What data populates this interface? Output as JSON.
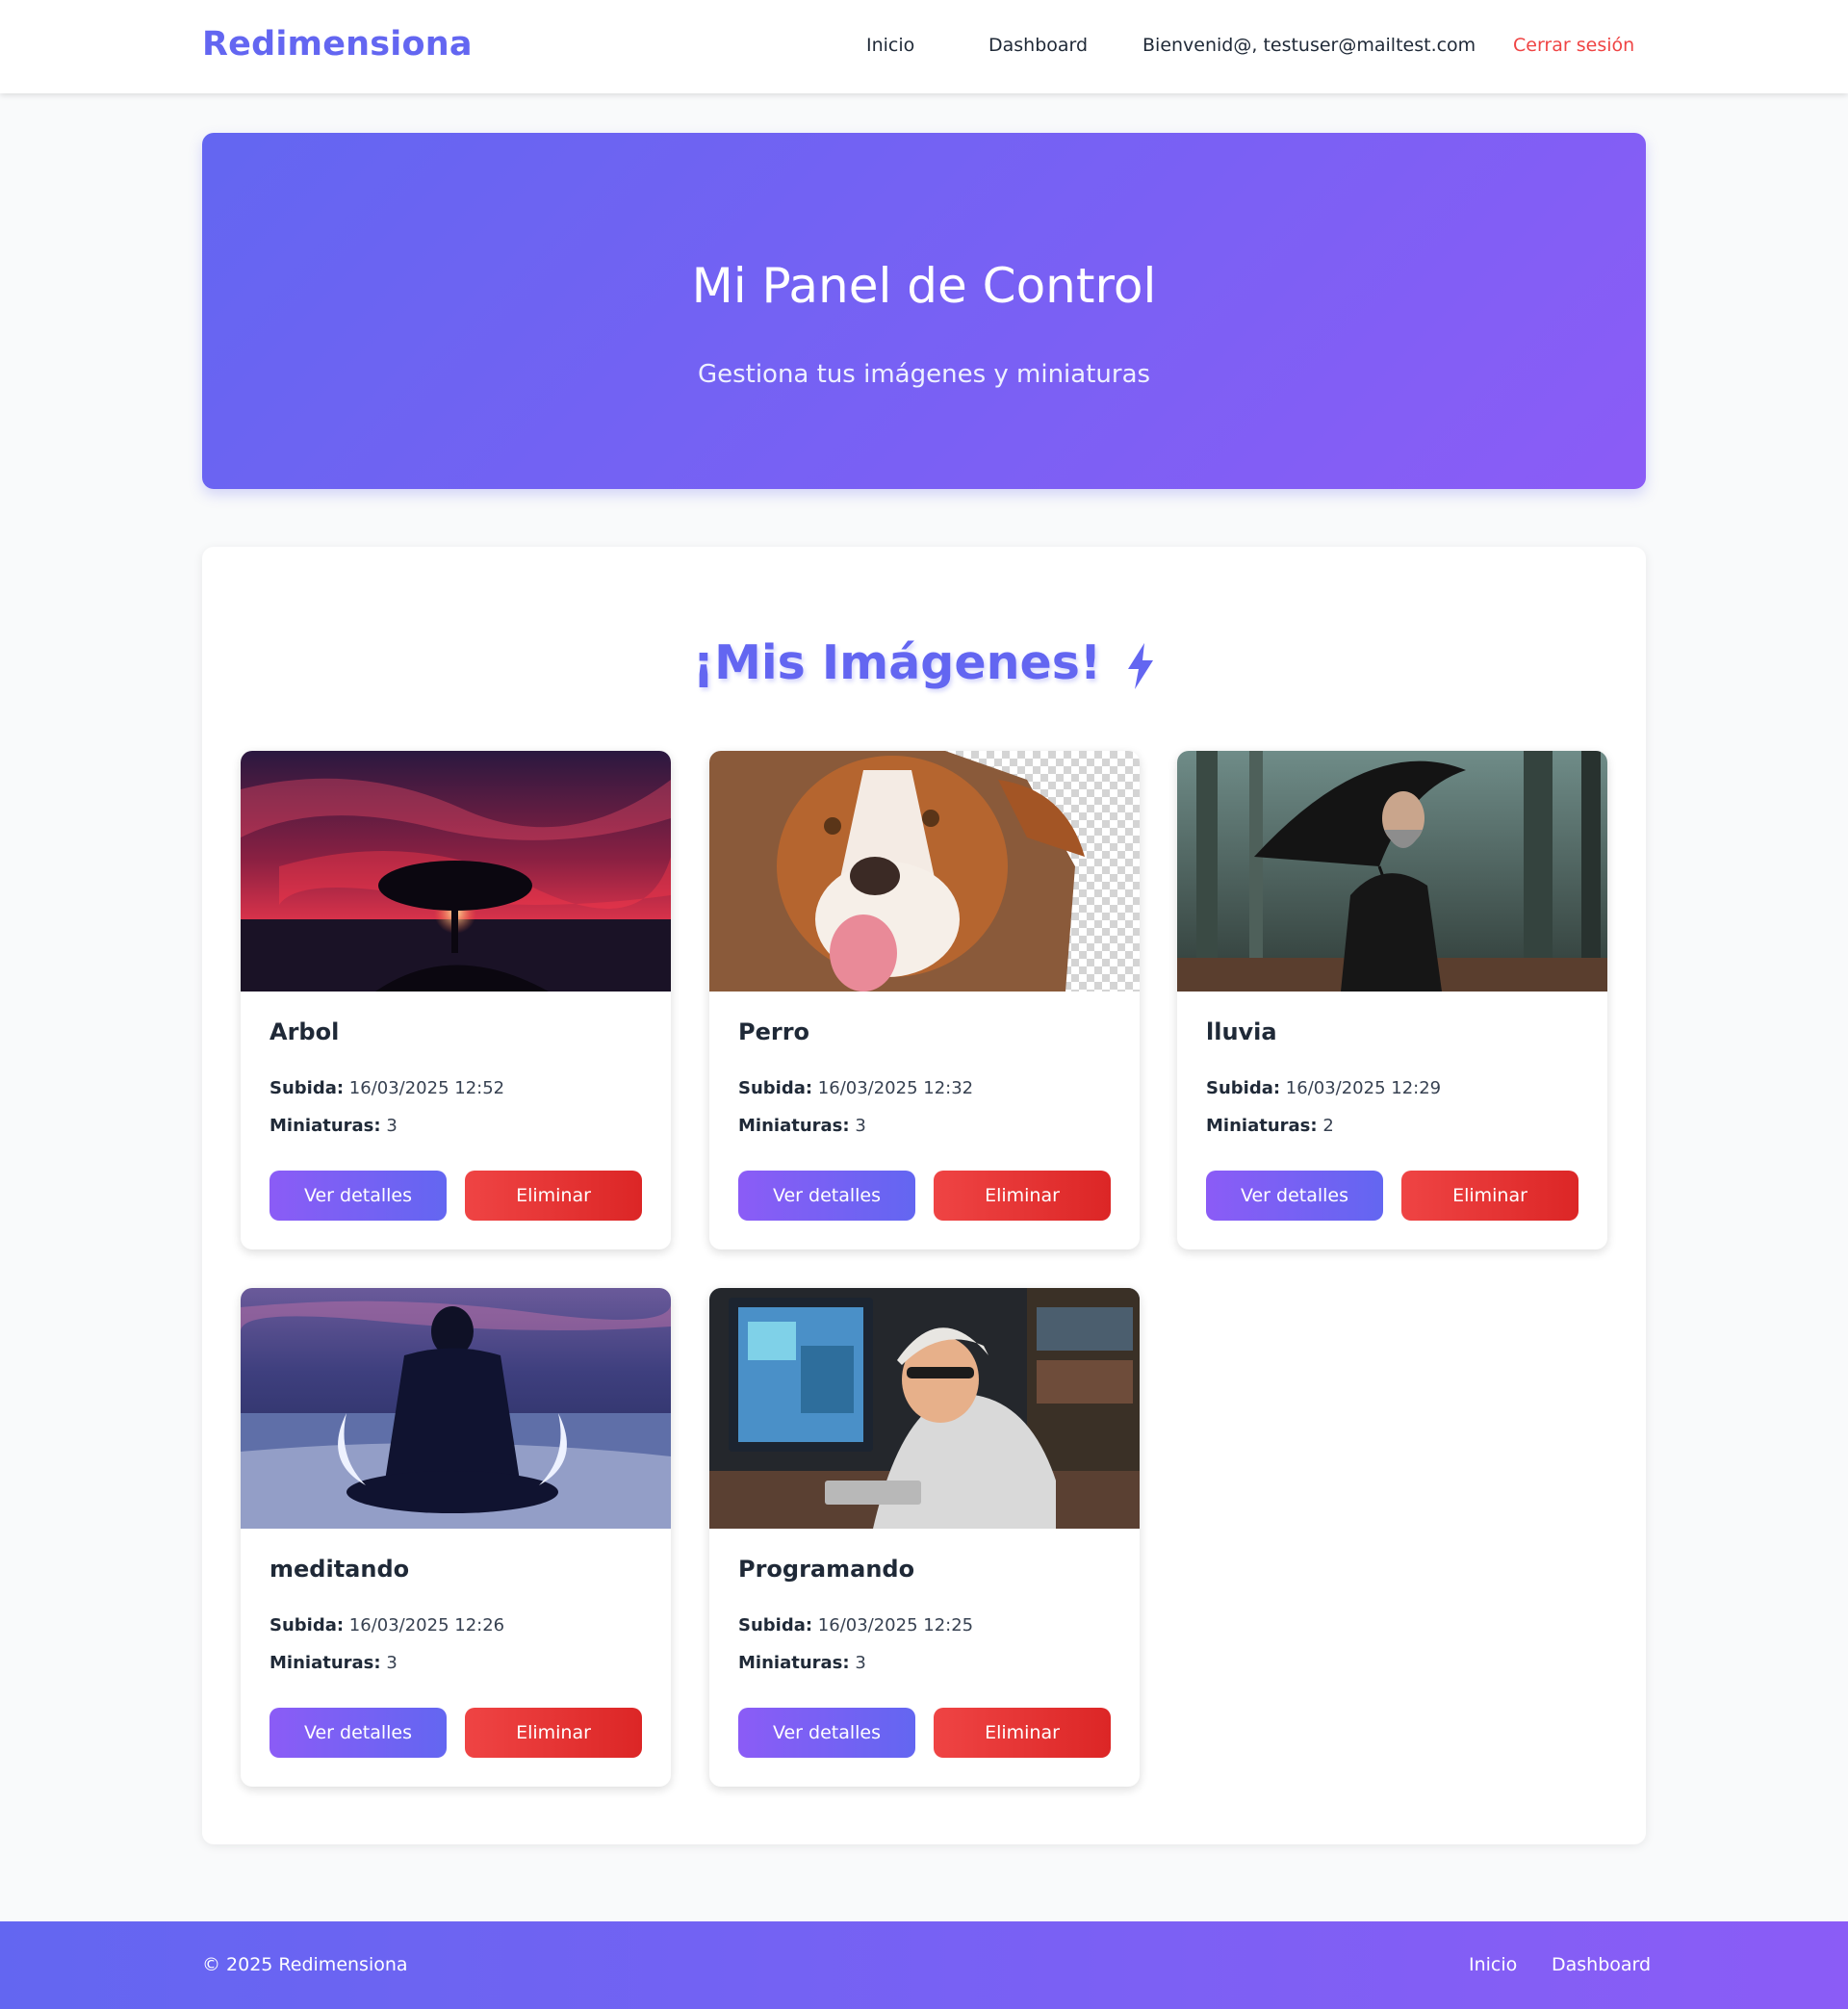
{
  "header": {
    "brand": "Redimensiona",
    "nav": {
      "inicio": "Inicio",
      "dashboard": "Dashboard",
      "welcome": "Bienvenid@, testuser@mailtest.com",
      "logout": "Cerrar sesión"
    }
  },
  "hero": {
    "title": "Mi Panel de Control",
    "subtitle": "Gestiona tus imágenes y miniaturas"
  },
  "gallery": {
    "heading": "¡Mis Imágenes!",
    "heading_icon": "lightning-bolt-icon",
    "uploaded_label": "Subida:",
    "thumbs_label": "Miniaturas:",
    "view_label": "Ver detalles",
    "delete_label": "Eliminar",
    "images": [
      {
        "title": "Arbol",
        "uploaded": "16/03/2025 12:52",
        "thumbnails": "3"
      },
      {
        "title": "Perro",
        "uploaded": "16/03/2025 12:32",
        "thumbnails": "3"
      },
      {
        "title": "lluvia",
        "uploaded": "16/03/2025 12:29",
        "thumbnails": "2"
      },
      {
        "title": "meditando",
        "uploaded": "16/03/2025 12:26",
        "thumbnails": "3"
      },
      {
        "title": "Programando",
        "uploaded": "16/03/2025 12:25",
        "thumbnails": "3"
      }
    ]
  },
  "footer": {
    "copyright": "© 2025 Redimensiona",
    "links": {
      "inicio": "Inicio",
      "dashboard": "Dashboard"
    }
  },
  "colors": {
    "accent": "#6366f1",
    "accent_secondary": "#8b5cf6",
    "danger": "#ef4444"
  }
}
